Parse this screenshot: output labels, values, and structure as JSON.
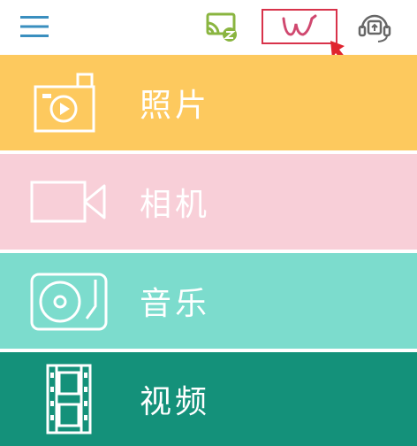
{
  "app": {
    "accent_annotation": "#d8324a",
    "colors": {
      "photos": "#fdc95e",
      "camera": "#f8cfd8",
      "music": "#7cdccd",
      "video": "#14917a",
      "menu_icon": "#3a8fbf",
      "cast_icon": "#8ab540"
    }
  },
  "toolbar": {
    "icons": [
      "hamburger-menu-icon",
      "cast-icon",
      "w-brand-icon",
      "support-headset-icon"
    ]
  },
  "tiles": [
    {
      "label": "照片",
      "icon": "photo-camera-icon"
    },
    {
      "label": "相机",
      "icon": "video-camera-icon"
    },
    {
      "label": "音乐",
      "icon": "turntable-icon"
    },
    {
      "label": "视频",
      "icon": "film-strip-icon"
    }
  ]
}
